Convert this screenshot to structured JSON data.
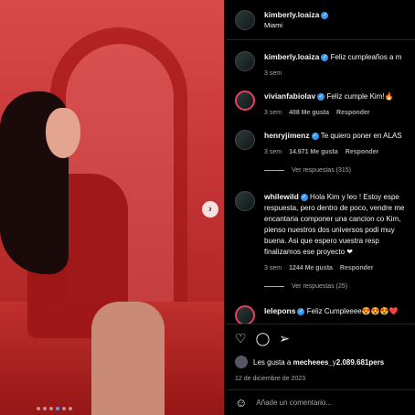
{
  "post": {
    "author": "kimberly.loaiza",
    "location": "Miami",
    "caption": "Feliz cumpleaños a m",
    "caption_time": "3 sem"
  },
  "comments": [
    {
      "user": "vivianfabiolav",
      "text": "Feliz cumple Kim!🔥",
      "time": "3 sem",
      "likes": "408 Me gusta",
      "reply_label": "Responder"
    },
    {
      "user": "henryjimenz",
      "text": "Te quiero poner en ALAS",
      "time": "3 sem",
      "likes": "14.971 Me gusta",
      "reply_label": "Responder",
      "view_replies": "Ver respuestas (315)"
    },
    {
      "user": "whilewild",
      "text": "Hola Kim y leo ! Estoy espe respuesta, pero dentro de poco, vendre me encantaria componer una cancion co Kim, pienso nuestros dos universos podi muy buena. Asi que espero vuestra resp finalizamos ese proyecto ❤",
      "time": "3 sem",
      "likes": "1244 Me gusta",
      "reply_label": "Responder",
      "view_replies": "Ver respuestas (25)"
    },
    {
      "user": "lelepons",
      "text": "Feliz Cumpleeee😍😍😍❤️"
    }
  ],
  "actions": {
    "likes_prefix": "Les gusta a",
    "likes_user": "mecheees_",
    "likes_middle": " y ",
    "likes_count": "2.089.681",
    "likes_suffix": " pers",
    "date": "12 de diciembre de 2023"
  },
  "add_comment": {
    "placeholder": "Añade un comentario..."
  },
  "carousel": {
    "next_glyph": "›",
    "slides": 6,
    "active_slide": 3
  },
  "icons": [
    "heart-icon",
    "comment-icon",
    "share-icon",
    "emoji-icon"
  ],
  "colors": {
    "background": "#000000",
    "verified": "#3897f0",
    "muted_text": "#a8a8a8"
  }
}
